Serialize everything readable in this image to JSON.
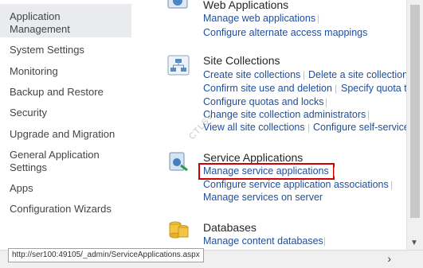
{
  "left_nav": {
    "items": [
      {
        "label": "Application\nManagement",
        "selected": true
      },
      {
        "label": "System Settings"
      },
      {
        "label": "Monitoring"
      },
      {
        "label": "Backup and Restore"
      },
      {
        "label": "Security"
      },
      {
        "label": "Upgrade and Migration"
      },
      {
        "label": "General Application\nSettings"
      },
      {
        "label": "Apps"
      },
      {
        "label": "Configuration Wizards"
      }
    ]
  },
  "sections": {
    "web_applications": {
      "title": "Web Applications",
      "links": [
        "Manage web applications",
        "Configure alternate access mappings"
      ]
    },
    "site_collections": {
      "title": "Site Collections",
      "links": [
        "Create site collections",
        "Delete a site collection",
        "Confirm site use and deletion",
        "Specify quota t",
        "Configure quotas and locks",
        "Change site collection administrators",
        "View all site collections",
        "Configure self-service"
      ]
    },
    "service_applications": {
      "title": "Service Applications",
      "links": [
        "Manage service applications",
        "Configure service application associations",
        "Manage services on server"
      ]
    },
    "databases": {
      "title": "Databases",
      "links": [
        "Manage content databases"
      ]
    }
  },
  "watermark": "CTLSV",
  "status_url": "http://ser100:49105/_admin/ServiceApplications.aspx",
  "colors": {
    "link": "#1f4e9c",
    "highlight_box": "#d10000",
    "nav_selected": "#e9ebee"
  }
}
